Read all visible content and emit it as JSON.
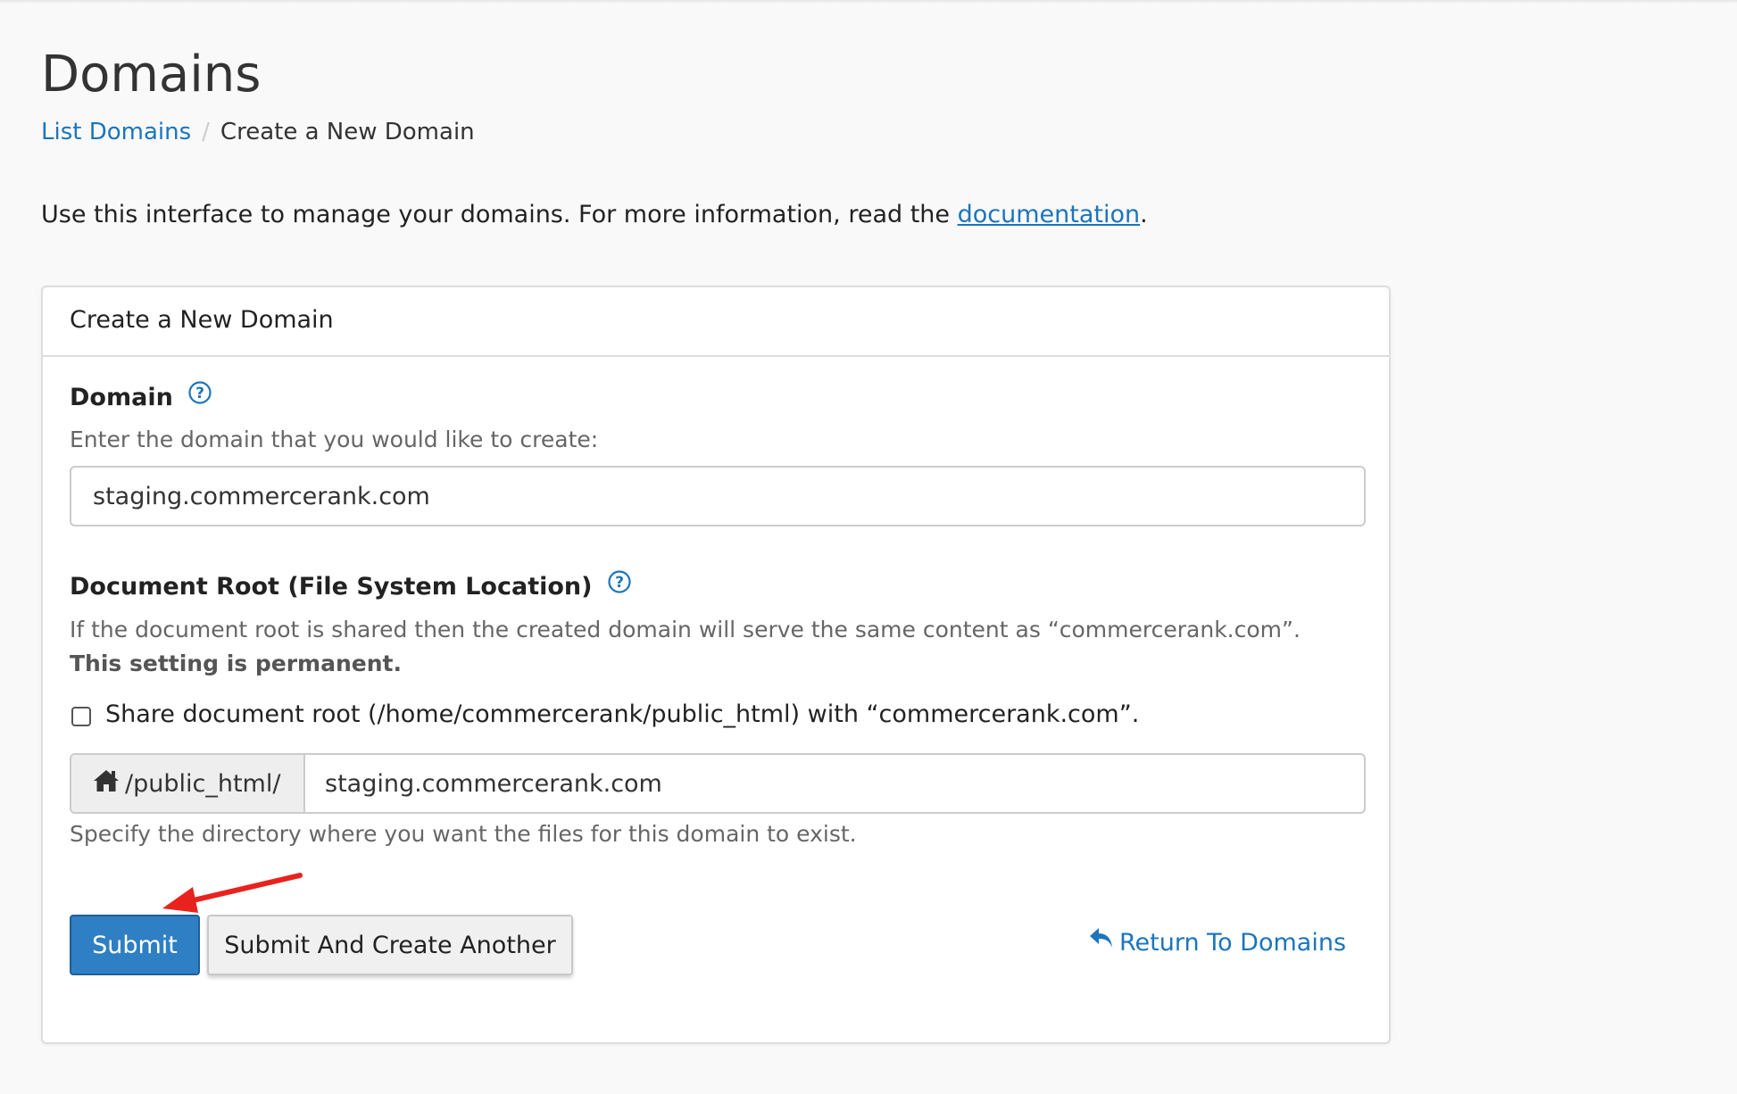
{
  "page": {
    "title": "Domains",
    "breadcrumb": {
      "parent": "List Domains",
      "separator": "/",
      "current": "Create a New Domain"
    },
    "intro": {
      "text": "Use this interface to manage your domains. For more information, read the ",
      "link": "documentation",
      "suffix": "."
    }
  },
  "panel": {
    "heading": "Create a New Domain",
    "domain": {
      "label": "Domain",
      "hint": "Enter the domain that you would like to create:",
      "value": "staging.commercerank.com"
    },
    "docroot": {
      "label": "Document Root (File System Location)",
      "hint_text": "If the document root is shared then the created domain will serve the same content as “commercerank.com”. ",
      "hint_bold": "This setting is permanent.",
      "share_checkbox_label": "Share document root (/home/commercerank/public_html) with “commercerank.com”.",
      "share_checked": false,
      "prefix": "/public_html/",
      "value": "staging.commercerank.com",
      "help_text": "Specify the directory where you want the files for this domain to exist."
    },
    "actions": {
      "submit": "Submit",
      "submit_another": "Submit And Create Another",
      "return": "Return To Domains"
    }
  },
  "colors": {
    "link": "#1c75bc",
    "primary_button": "#2e7fc4",
    "annotation_arrow": "#e8231d"
  },
  "icons": [
    "help-icon",
    "home-icon",
    "undo-icon"
  ]
}
